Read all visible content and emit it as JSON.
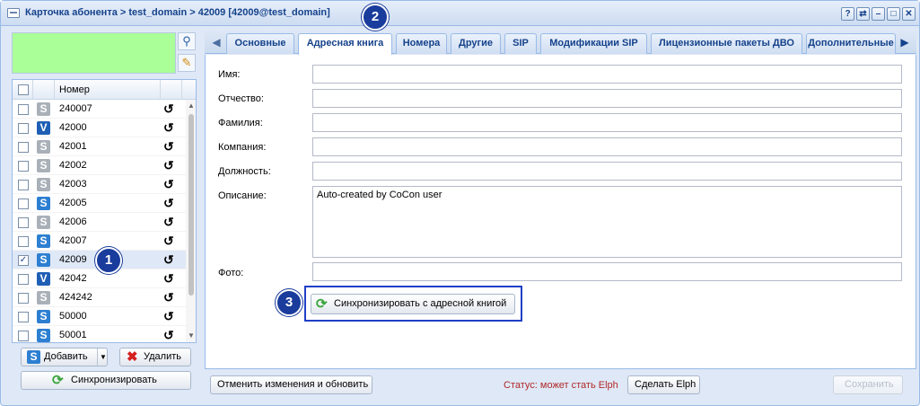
{
  "window": {
    "title": "Карточка абонента > test_domain > 42009 [42009@test_domain]",
    "tools": [
      "?",
      "⇄",
      "–",
      "□",
      "✕"
    ]
  },
  "left": {
    "grid": {
      "header": "Номер",
      "rows": [
        {
          "number": "240007",
          "type": "S",
          "color": "grey",
          "checked": false
        },
        {
          "number": "42000",
          "type": "V",
          "color": "blue",
          "checked": false
        },
        {
          "number": "42001",
          "type": "S",
          "color": "grey",
          "checked": false
        },
        {
          "number": "42002",
          "type": "S",
          "color": "grey",
          "checked": false
        },
        {
          "number": "42003",
          "type": "S",
          "color": "grey",
          "checked": false
        },
        {
          "number": "42005",
          "type": "S",
          "color": "blue",
          "checked": false
        },
        {
          "number": "42006",
          "type": "S",
          "color": "grey",
          "checked": false
        },
        {
          "number": "42007",
          "type": "S",
          "color": "blue",
          "checked": false
        },
        {
          "number": "42009",
          "type": "S",
          "color": "blue",
          "checked": true
        },
        {
          "number": "42042",
          "type": "V",
          "color": "blue",
          "checked": false
        },
        {
          "number": "424242",
          "type": "S",
          "color": "grey",
          "checked": false
        },
        {
          "number": "50000",
          "type": "S",
          "color": "blue",
          "checked": false
        },
        {
          "number": "50001",
          "type": "S",
          "color": "blue",
          "checked": false
        }
      ]
    },
    "add_label": "Добавить",
    "delete_label": "Удалить",
    "sync_label": "Синхронизировать"
  },
  "tabs": [
    {
      "label": "Основные",
      "active": false
    },
    {
      "label": "Адресная книга",
      "active": true
    },
    {
      "label": "Номера",
      "active": false
    },
    {
      "label": "Другие",
      "active": false
    },
    {
      "label": "SIP",
      "active": false
    },
    {
      "label": "Модификации SIP",
      "active": false
    },
    {
      "label": "Лицензионные пакеты ДВО",
      "active": false
    },
    {
      "label": "Дополнительные",
      "active": false
    }
  ],
  "form": {
    "first_name_label": "Имя:",
    "middle_name_label": "Отчество:",
    "last_name_label": "Фамилия:",
    "company_label": "Компания:",
    "position_label": "Должность:",
    "description_label": "Описание:",
    "description_value": "Auto-created by CoCon user",
    "photo_label": "Фото:",
    "sync_button_label": "Синхронизировать с адресной книгой"
  },
  "footer": {
    "revert_label": "Отменить изменения и обновить",
    "status_text": "Статус: может стать Elph",
    "make_elph_label": "Сделать Elph",
    "save_label": "Сохранить"
  },
  "callouts": [
    "1",
    "2",
    "3"
  ]
}
